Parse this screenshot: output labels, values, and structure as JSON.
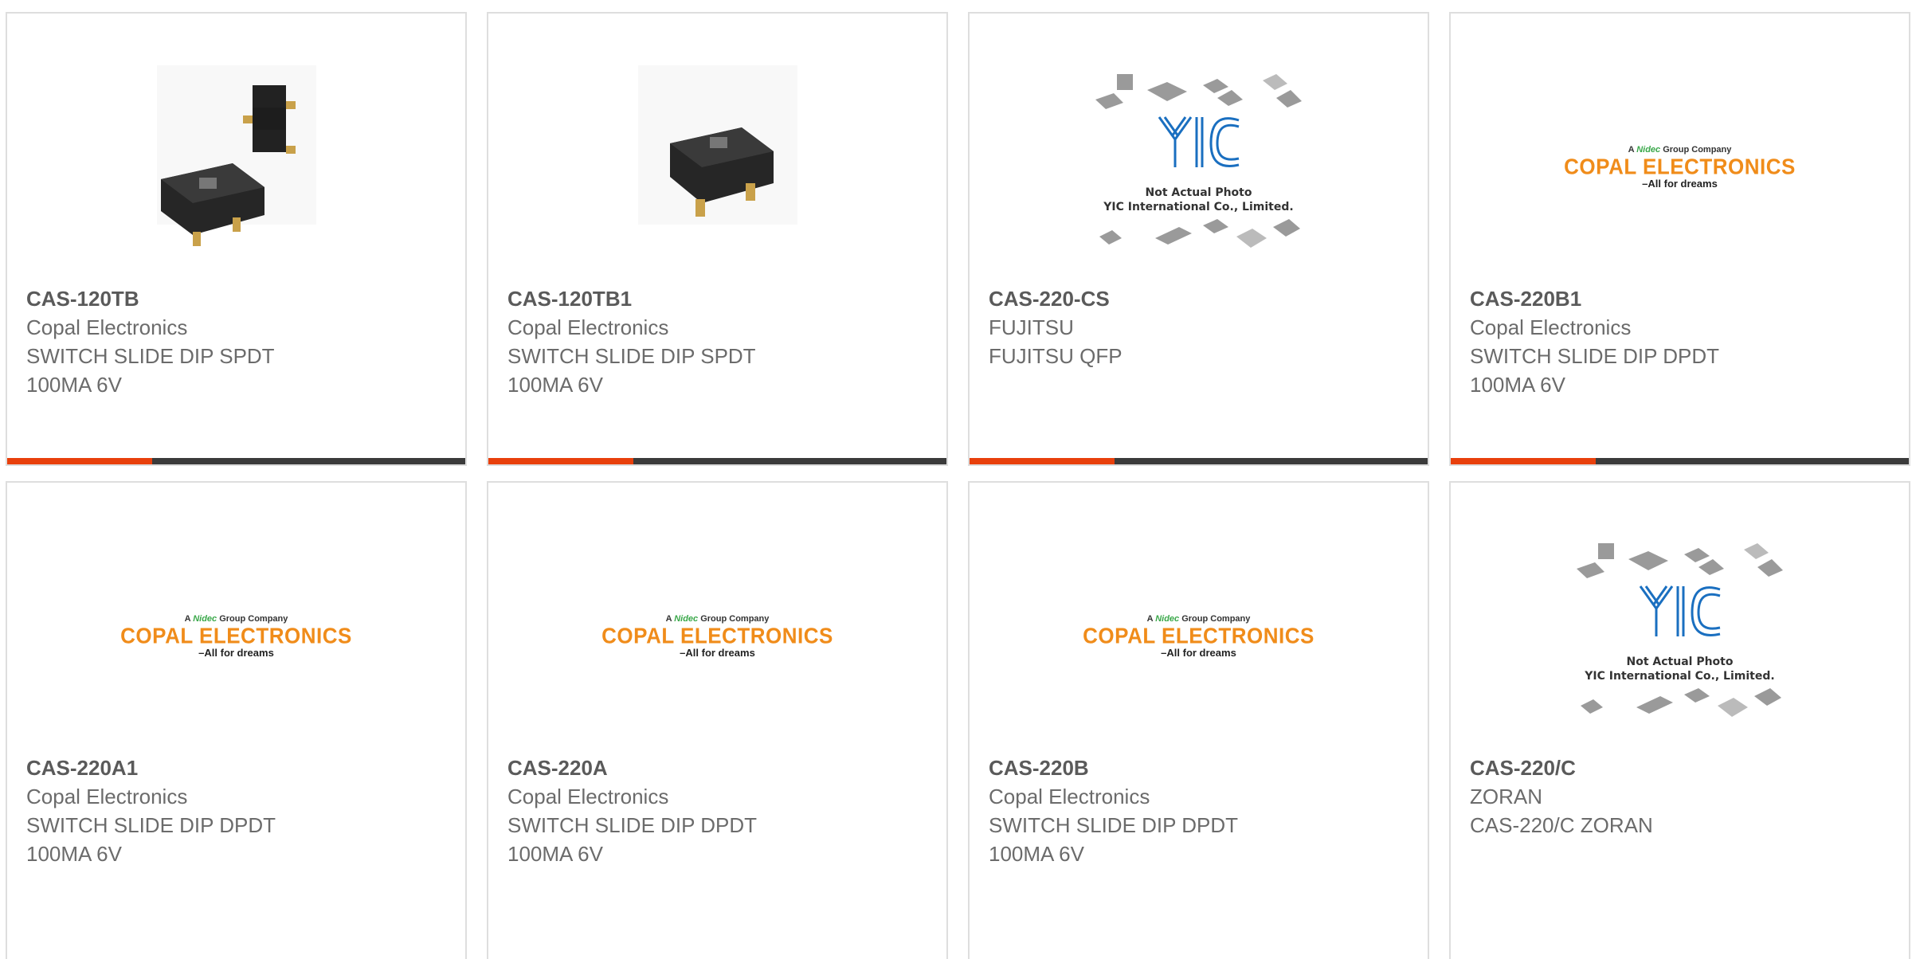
{
  "products": [
    {
      "part_number": "CAS-120TB",
      "manufacturer": "Copal Electronics",
      "description": "SWITCH SLIDE DIP SPDT\n100MA 6V",
      "image": "switch-photo-double-icon"
    },
    {
      "part_number": "CAS-120TB1",
      "manufacturer": "Copal Electronics",
      "description": "SWITCH SLIDE DIP SPDT\n100MA 6V",
      "image": "switch-photo-single-icon"
    },
    {
      "part_number": "CAS-220-CS",
      "manufacturer": "FUJITSU",
      "description": "FUJITSU QFP",
      "image": "yic-placeholder-icon"
    },
    {
      "part_number": "CAS-220B1",
      "manufacturer": "Copal Electronics",
      "description": "SWITCH SLIDE DIP DPDT\n100MA 6V",
      "image": "copal-logo"
    },
    {
      "part_number": "CAS-220A1",
      "manufacturer": "Copal Electronics",
      "description": "SWITCH SLIDE DIP DPDT\n100MA 6V",
      "image": "copal-logo"
    },
    {
      "part_number": "CAS-220A",
      "manufacturer": "Copal Electronics",
      "description": "SWITCH SLIDE DIP DPDT\n100MA 6V",
      "image": "copal-logo"
    },
    {
      "part_number": "CAS-220B",
      "manufacturer": "Copal Electronics",
      "description": "SWITCH SLIDE DIP DPDT\n100MA 6V",
      "image": "copal-logo"
    },
    {
      "part_number": "CAS-220/C",
      "manufacturer": "ZORAN",
      "description": "CAS-220/C ZORAN",
      "image": "yic-placeholder-icon"
    }
  ],
  "copal_logo": {
    "group_prefix": "A",
    "group_brand": "Nidec",
    "group_suffix": "Group Company",
    "name": "COPAL ELECTRONICS",
    "tagline": "–All for dreams"
  },
  "yic_placeholder": {
    "line1": "Not Actual Photo",
    "line2": "YIC International Co., Limited."
  },
  "colors": {
    "accent": "#e8400c",
    "bar": "#3b3b3b",
    "border": "#dedede",
    "copal_orange": "#f08c1a",
    "yic_blue": "#1a6fc0"
  }
}
